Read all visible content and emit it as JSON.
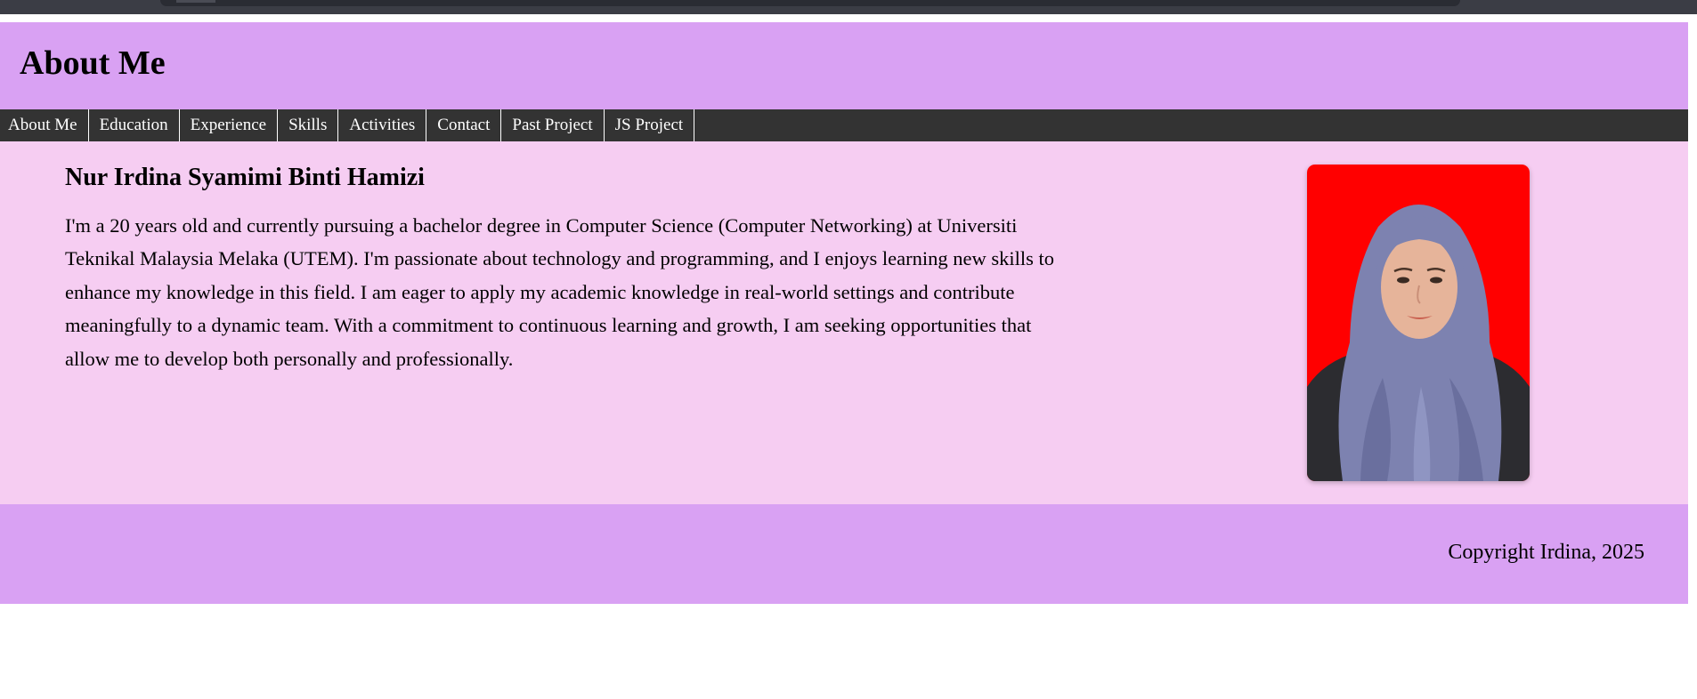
{
  "header": {
    "title": "About Me"
  },
  "nav": {
    "items": [
      {
        "label": "About Me"
      },
      {
        "label": "Education"
      },
      {
        "label": "Experience"
      },
      {
        "label": "Skills"
      },
      {
        "label": "Activities"
      },
      {
        "label": "Contact"
      },
      {
        "label": "Past Project"
      },
      {
        "label": "JS Project"
      }
    ]
  },
  "main": {
    "name": "Nur Irdina Syamimi Binti Hamizi",
    "bio": "I'm a 20 years old and currently pursuing a bachelor degree in Computer Science (Computer Networking) at Universiti Teknikal Malaysia Melaka (UTEM). I'm passionate about technology and programming, and I enjoys learning new skills to enhance my knowledge in this field. I am eager to apply my academic knowledge in real-world settings and contribute meaningfully to a dynamic team. With a commitment to continuous learning and growth, I am seeking opportunities that allow me to develop both personally and professionally."
  },
  "footer": {
    "copyright": "Copyright Irdina, 2025"
  },
  "colors": {
    "header_bg": "#d9a1f3",
    "nav_bg": "#333333",
    "content_bg": "#f6cdf2",
    "photo_bg": "#ff0000"
  }
}
